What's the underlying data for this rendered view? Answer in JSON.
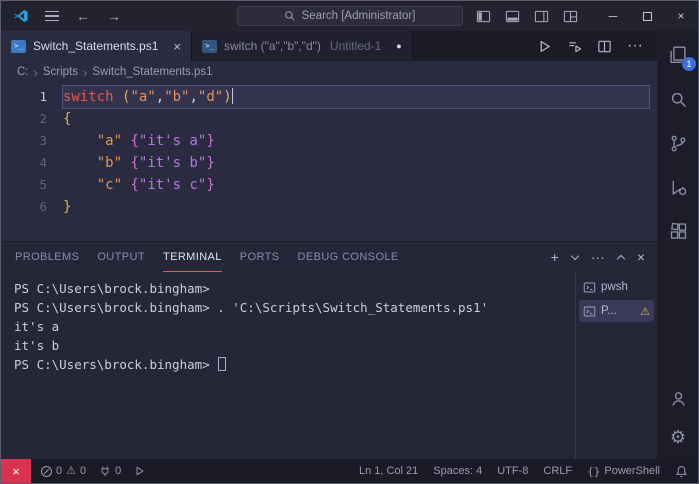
{
  "icons": {
    "back": "←",
    "forward": "→",
    "minimize": "─",
    "close": "×",
    "more": "···",
    "plus": "+",
    "modified_dot": "●",
    "warning": "⚠",
    "gear": "⚙",
    "breadcrumb_sep": "›",
    "braces": "{}",
    "ps_glyph": ">_"
  },
  "title_bar": {
    "search_text": "Search [Administrator]"
  },
  "tabs": [
    {
      "label": "Switch_Statements.ps1"
    },
    {
      "label": "switch (\"a\",\"b\",\"d\")",
      "secondary": "Untitled-1"
    }
  ],
  "breadcrumb": [
    "C:",
    "Scripts",
    "Switch_Statements.ps1"
  ],
  "editor": {
    "lines": [
      {
        "num": "1",
        "current": true,
        "tokens": [
          [
            "kw",
            "switch"
          ],
          [
            "pl",
            " "
          ],
          [
            "br1",
            "("
          ],
          [
            "str",
            "\"a\""
          ],
          [
            "pl",
            ","
          ],
          [
            "str",
            "\"b\""
          ],
          [
            "pl",
            ","
          ],
          [
            "str",
            "\"d\""
          ],
          [
            "br1",
            ")"
          ]
        ]
      },
      {
        "num": "2",
        "current": false,
        "tokens": [
          [
            "br1",
            "{"
          ]
        ]
      },
      {
        "num": "3",
        "current": false,
        "tokens": [
          [
            "pl",
            "    "
          ],
          [
            "str",
            "\"a\""
          ],
          [
            "pl",
            " "
          ],
          [
            "br2",
            "{"
          ],
          [
            "str2",
            "\"it's a\""
          ],
          [
            "br2",
            "}"
          ]
        ]
      },
      {
        "num": "4",
        "current": false,
        "tokens": [
          [
            "pl",
            "    "
          ],
          [
            "str",
            "\"b\""
          ],
          [
            "pl",
            " "
          ],
          [
            "br2",
            "{"
          ],
          [
            "str2",
            "\"it's b\""
          ],
          [
            "br2",
            "}"
          ]
        ]
      },
      {
        "num": "5",
        "current": false,
        "tokens": [
          [
            "pl",
            "    "
          ],
          [
            "str",
            "\"c\""
          ],
          [
            "pl",
            " "
          ],
          [
            "br2",
            "{"
          ],
          [
            "str2",
            "\"it's c\""
          ],
          [
            "br2",
            "}"
          ]
        ]
      },
      {
        "num": "6",
        "current": false,
        "tokens": [
          [
            "br1",
            "}"
          ]
        ]
      }
    ]
  },
  "panel": {
    "tabs": [
      {
        "label": "PROBLEMS",
        "active": false
      },
      {
        "label": "OUTPUT",
        "active": false
      },
      {
        "label": "TERMINAL",
        "active": true
      },
      {
        "label": "PORTS",
        "active": false
      },
      {
        "label": "DEBUG CONSOLE",
        "active": false
      }
    ],
    "terminal_lines": [
      {
        "text": "PS C:\\Users\\brock.bingham>",
        "cursor": false
      },
      {
        "text": "PS C:\\Users\\brock.bingham> . 'C:\\Scripts\\Switch_Statements.ps1'",
        "cursor": false
      },
      {
        "text": "it's a",
        "cursor": false
      },
      {
        "text": "it's b",
        "cursor": false
      },
      {
        "text": "PS C:\\Users\\brock.bingham> ",
        "cursor": true
      }
    ],
    "terminal_list": [
      {
        "label": "pwsh",
        "warning": false,
        "selected": false
      },
      {
        "label": "P...",
        "warning": true,
        "selected": true
      }
    ]
  },
  "activity": {
    "badge": "1"
  },
  "status_bar": {
    "errors": "0",
    "warnings": "0",
    "ports": "0",
    "line_col": "Ln 1, Col 21",
    "spaces": "Spaces: 4",
    "encoding": "UTF-8",
    "eol": "CRLF",
    "language": "PowerShell"
  }
}
